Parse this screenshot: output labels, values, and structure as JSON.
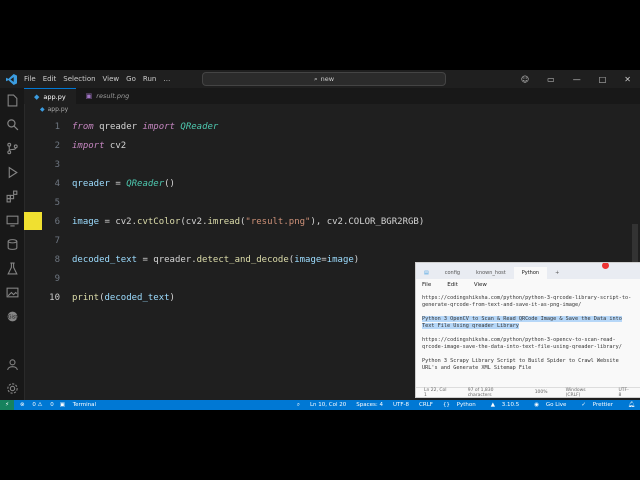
{
  "titlebar": {
    "menu": [
      "File",
      "Edit",
      "Selection",
      "View",
      "Go",
      "Run",
      "…"
    ],
    "search": "new"
  },
  "tabs": [
    {
      "label": "app.py",
      "active": true
    },
    {
      "label": "result.png",
      "active": false
    }
  ],
  "breadcrumb": "app.py",
  "editor": {
    "lines": [
      {
        "num": "1",
        "tokens": [
          {
            "t": "from",
            "c": "kw"
          },
          {
            "t": " qreader ",
            "c": ""
          },
          {
            "t": "import",
            "c": "kw"
          },
          {
            "t": " ",
            "c": ""
          },
          {
            "t": "QReader",
            "c": "cls"
          }
        ]
      },
      {
        "num": "2",
        "tokens": [
          {
            "t": "import",
            "c": "kw"
          },
          {
            "t": " cv2",
            "c": ""
          }
        ]
      },
      {
        "num": "3",
        "tokens": []
      },
      {
        "num": "4",
        "tokens": [
          {
            "t": "qreader",
            "c": "var"
          },
          {
            "t": " = ",
            "c": ""
          },
          {
            "t": "QReader",
            "c": "cls"
          },
          {
            "t": "()",
            "c": ""
          }
        ]
      },
      {
        "num": "5",
        "tokens": []
      },
      {
        "num": "6",
        "tokens": [
          {
            "t": "image",
            "c": "var"
          },
          {
            "t": " = cv2.",
            "c": ""
          },
          {
            "t": "cvtColor",
            "c": "fn"
          },
          {
            "t": "(cv2.",
            "c": ""
          },
          {
            "t": "imread",
            "c": "fn"
          },
          {
            "t": "(",
            "c": ""
          },
          {
            "t": "\"result.png\"",
            "c": "str"
          },
          {
            "t": "), cv2.COLOR_BGR2RGB)",
            "c": ""
          }
        ]
      },
      {
        "num": "7",
        "tokens": []
      },
      {
        "num": "8",
        "tokens": [
          {
            "t": "decoded_text",
            "c": "var"
          },
          {
            "t": " = qreader.",
            "c": ""
          },
          {
            "t": "detect_and_decode",
            "c": "fn"
          },
          {
            "t": "(",
            "c": ""
          },
          {
            "t": "image",
            "c": "var"
          },
          {
            "t": "=",
            "c": ""
          },
          {
            "t": "image",
            "c": "var"
          },
          {
            "t": ")",
            "c": ""
          }
        ]
      },
      {
        "num": "9",
        "tokens": []
      },
      {
        "num": "10",
        "tokens": [
          {
            "t": "print",
            "c": "fn"
          },
          {
            "t": "(",
            "c": ""
          },
          {
            "t": "decoded_text",
            "c": "var"
          },
          {
            "t": ")",
            "c": ""
          }
        ]
      }
    ]
  },
  "status": {
    "errors": "0",
    "warnings": "0",
    "terminal": "Terminal",
    "position": "Ln 10, Col 20",
    "spaces": "Spaces: 4",
    "encoding": "UTF-8",
    "eol": "CRLF",
    "language": "Python",
    "version": "3.10.5",
    "golive": "Go Live",
    "prettier": "Prettier"
  },
  "notepad": {
    "tabs": [
      "config",
      "known_host",
      "Python"
    ],
    "menu": [
      "File",
      "Edit",
      "View"
    ],
    "paragraphs": [
      {
        "text": "https://codingshiksha.com/python/python-3-qrcode-library-script-to-generate-qrcode-from-text-and-save-it-as-png-image/",
        "highlight": false
      },
      {
        "text": "Python 3 OpenCV to Scan & Read QRCode Image & Save the Data into Text File Using qreader Library",
        "highlight": true
      },
      {
        "text": "https://codingshiksha.com/python/python-3-opencv-to-scan-read-qrcode-image-save-the-data-into-text-file-using-qreader-library/",
        "highlight": false
      },
      {
        "text": "Python 3 Scrapy Library Script to Build Spider to Crawl Website URL's and Generate XML Sitemap File",
        "highlight": false
      }
    ],
    "status": [
      "Ln 22, Col 1",
      "97 of 1,830 characters",
      "100%",
      "Windows (CRLF)",
      "UTF-8"
    ]
  },
  "colors": {
    "accent": "#0078d4",
    "qr_marker": "#f0e030"
  }
}
